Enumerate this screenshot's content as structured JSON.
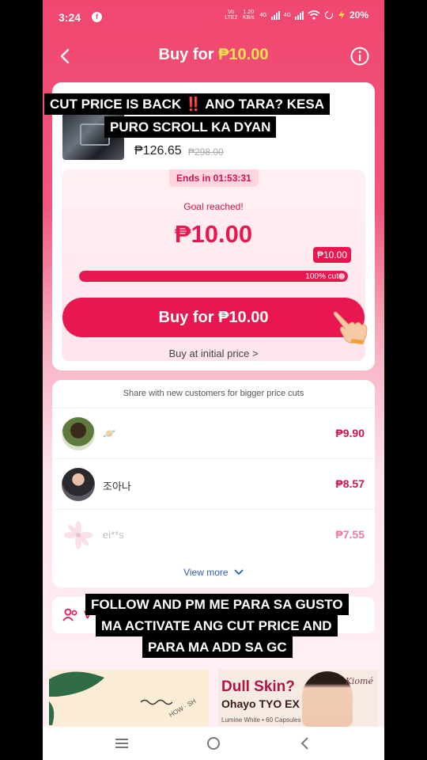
{
  "status": {
    "time": "3:24",
    "fb_badge": "f",
    "net_volte": "Vo LTE2",
    "net_speed": "1.20 KB/s",
    "net_4g_a": "4G",
    "net_4g_b": "4G",
    "battery": "20%"
  },
  "header": {
    "prefix": "Buy for ",
    "price": "₱10.00"
  },
  "product": {
    "price": "₱126.65",
    "original_price": "₱298.00"
  },
  "deal": {
    "ends_label": "Ends in 01:53:31",
    "goal_text": "Goal reached!",
    "price": "₱10.00",
    "bubble": "₱10.00",
    "progress_label": "100% cut",
    "progress_percent": 100,
    "buy_button": "Buy for ₱10.00",
    "initial_link": "Buy at initial price >"
  },
  "captions": {
    "top_line1": "CUT PRICE IS BACK ‼️ ANO TARA? KESA",
    "top_line2": "PURO SCROLL KA DYAN",
    "bottom_line1": "FOLLOW AND PM ME PARA SA GUSTO",
    "bottom_line2": "MA ACTIVATE ANG CUT PRICE AND",
    "bottom_line3": "PARA MA ADD SA GC"
  },
  "share": {
    "title": "Share with new customers for bigger price cuts",
    "rows": [
      {
        "name": "🪐",
        "amount": "₱9.90"
      },
      {
        "name": "조아나",
        "amount": "₱8.57"
      },
      {
        "name": "ei**s",
        "amount": "₱7.55"
      }
    ],
    "view_more": "View more"
  },
  "invite": {
    "icon": "users-icon",
    "text": "V"
  },
  "ads": {
    "left_text": "HOW · SH",
    "right_title": "Dull Skin?",
    "right_sub": "Ohayo TYO EX",
    "right_small": "Lumine White • 60 Capsules",
    "right_brand": "Kiomé"
  },
  "colors": {
    "accent": "#e8174f",
    "header_price": "#ffe14d",
    "link": "#2b5fb4"
  }
}
